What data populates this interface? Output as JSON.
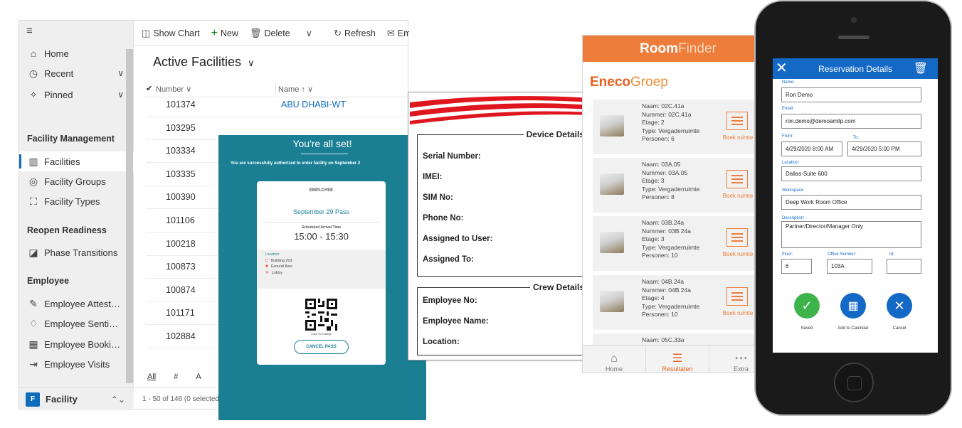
{
  "dynamics": {
    "nav": {
      "items": [
        {
          "label": "Home",
          "icon": "home-icon",
          "glyph": "⌂"
        },
        {
          "label": "Recent",
          "icon": "clock-icon",
          "glyph": "◷",
          "chevron": "∨"
        },
        {
          "label": "Pinned",
          "icon": "pin-icon",
          "glyph": "✧",
          "chevron": "∨"
        }
      ],
      "groups": [
        {
          "title": "Facility Management",
          "items": [
            {
              "label": "Facilities",
              "icon": "building-icon",
              "glyph": "▥",
              "selected": true
            },
            {
              "label": "Facility Groups",
              "icon": "group-icon",
              "glyph": "◎"
            },
            {
              "label": "Facility Types",
              "icon": "types-icon",
              "glyph": "⛶"
            }
          ]
        },
        {
          "title": "Reopen Readiness",
          "items": [
            {
              "label": "Phase Transitions",
              "icon": "phase-icon",
              "glyph": "◪"
            }
          ]
        },
        {
          "title": "Employee",
          "items": [
            {
              "label": "Employee Attestat...",
              "icon": "attest-icon",
              "glyph": "✎"
            },
            {
              "label": "Employee Sentime...",
              "icon": "thumbs-up-icon",
              "glyph": "♢"
            },
            {
              "label": "Employee Bookings",
              "icon": "calendar-icon",
              "glyph": "▦"
            },
            {
              "label": "Employee Visits",
              "icon": "signin-icon",
              "glyph": "⇥"
            }
          ]
        }
      ],
      "footer": {
        "badge": "F",
        "label": "Facility",
        "arrows": "⌃⌄"
      }
    },
    "commands": [
      {
        "label": "Show Chart",
        "icon": "chart-icon",
        "glyph": "◫"
      },
      {
        "label": "New",
        "icon": "plus-icon",
        "glyph": "+"
      },
      {
        "label": "Delete",
        "icon": "trash-icon",
        "glyph": "🗑"
      },
      {
        "label": "",
        "icon": "chevron-down-icon",
        "glyph": "∨"
      },
      {
        "label": "Refresh",
        "icon": "refresh-icon",
        "glyph": "↻"
      },
      {
        "label": "Ema",
        "icon": "mail-icon",
        "glyph": "✉"
      }
    ],
    "view_title": "Active Facilities",
    "view_chevron": "∨",
    "columns": {
      "number": "Number",
      "number_sort": "∨",
      "name": "Name",
      "name_sort": "↑  ∨",
      "check": "✔"
    },
    "rows": [
      {
        "number": "101374",
        "name": "ABU DHABI-WT"
      },
      {
        "number": "103295",
        "name": ""
      },
      {
        "number": "103334",
        "name": ""
      },
      {
        "number": "103335",
        "name": ""
      },
      {
        "number": "100390",
        "name": ""
      },
      {
        "number": "101106",
        "name": ""
      },
      {
        "number": "100218",
        "name": ""
      },
      {
        "number": "100873",
        "name": ""
      },
      {
        "number": "100874",
        "name": ""
      },
      {
        "number": "101171",
        "name": ""
      },
      {
        "number": "102884",
        "name": ""
      }
    ],
    "jumpbar": [
      "All",
      "#",
      "A"
    ],
    "status": "1 - 50 of 146 (0 selected)"
  },
  "pass": {
    "title": "You're all set!",
    "subtitle": "You are successfully authorized to enter facility on September 2",
    "employee_label": "EMPLOYEE",
    "pass_title": "September 29 Pass",
    "sched_label": "Scheduled Arrival Time",
    "sched_time": "15:00 - 15:30",
    "location_label": "Location:",
    "locations": [
      "Building 203",
      "Ground floor",
      "Lobby"
    ],
    "click_hint": "Click To Enlarge",
    "cancel": "CANCEL PASS",
    "accent": "#1b7f94"
  },
  "device": {
    "device_title": "Device Details",
    "device_fields": [
      "Serial Number:",
      "IMEI:",
      "SIM No:",
      "Phone No:",
      "Assigned to User:",
      "Assigned To:"
    ],
    "crew_title": "Crew Details",
    "crew_fields": [
      "Employee No:",
      "Employee Name:",
      "Location:"
    ]
  },
  "roomfinder": {
    "brand_bold": "Room",
    "brand_light": "Finder",
    "company_a": "Eneco",
    "company_b": "Groep",
    "accent": "#ee7d3b",
    "book_label": "Boek ruimte",
    "rooms": [
      {
        "naam": "Naam: 02C.41a",
        "nummer": "Nummer: 02C.41a",
        "etage": "Etage: 2",
        "type": "Type: Vergaderruimte",
        "personen": "Personen: 6"
      },
      {
        "naam": "Naam: 03A.05",
        "nummer": "Nummer: 03A.05",
        "etage": "Etage: 3",
        "type": "Type: Vergaderruimte",
        "personen": "Personen: 8"
      },
      {
        "naam": "Naam: 03B.24a",
        "nummer": "Nummer: 03B.24a",
        "etage": "Etage: 3",
        "type": "Type: Vergaderruimte",
        "personen": "Personen: 10"
      },
      {
        "naam": "Naam: 04B.24a",
        "nummer": "Nummer: 04B.24a",
        "etage": "Etage: 4",
        "type": "Type: Vergaderruimte",
        "personen": "Personen: 10"
      },
      {
        "naam": "Naam: 05C.33a",
        "nummer": "",
        "etage": "",
        "type": "",
        "personen": ""
      }
    ],
    "tabs": [
      {
        "label": "Home",
        "icon": "home-icon",
        "glyph": "⌂"
      },
      {
        "label": "Resultaten",
        "icon": "list-icon",
        "glyph": "☰",
        "active": true
      },
      {
        "label": "Extra",
        "icon": "more-icon",
        "glyph": "• • •"
      }
    ]
  },
  "reservation": {
    "title": "Reservation Details",
    "close_glyph": "✕",
    "trash_glyph": "🗑",
    "accent": "#1469c7",
    "name_label": "Name:",
    "name": "Ron Demo",
    "email_label": "Email:",
    "email": "ron.demo@demoamllp.com",
    "from_label": "From:",
    "from": "4/29/2020 8:00 AM",
    "to_label": "To:",
    "to": "4/29/2020 5:00 PM",
    "location_label": "Location:",
    "location": "Dallas-Suite 600",
    "workspace_label": "Workspace:",
    "workspace": "Deep Work Room Office",
    "description_label": "Description:",
    "description": "Partner/Director/Manager Only",
    "floor_label": "Floor:",
    "floor": "6",
    "office_label": "Office Number:",
    "office": "103A",
    "id_label": "Id:",
    "id": "",
    "actions": [
      {
        "label": "Saved",
        "icon": "check-icon",
        "glyph": "✓",
        "color": "#3cb44a"
      },
      {
        "label": "Add to Calendar",
        "icon": "calendar-icon",
        "glyph": "▦",
        "color": "#1469c7"
      },
      {
        "label": "Cancel",
        "icon": "close-icon",
        "glyph": "✕",
        "color": "#1469c7"
      }
    ]
  }
}
